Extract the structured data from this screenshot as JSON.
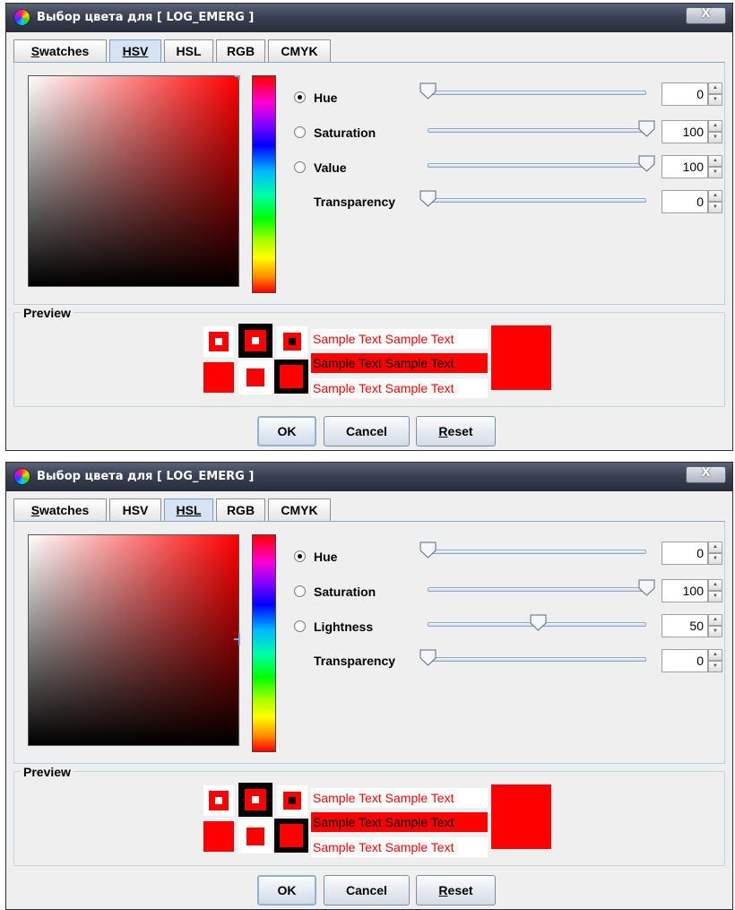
{
  "dialogs": [
    {
      "title": "Выбор цвета для [ LOG_EMERG ]",
      "close_label": "X",
      "tabs": [
        {
          "label": "Swatches",
          "mnemonic": "S",
          "selected": false
        },
        {
          "label": "HSV",
          "mnemonic": "H",
          "selected": true
        },
        {
          "label": "HSL",
          "mnemonic": "L",
          "selected": false
        },
        {
          "label": "RGB",
          "mnemonic": "G",
          "selected": false
        },
        {
          "label": "CMYK",
          "mnemonic": "M",
          "selected": false
        }
      ],
      "rows": [
        {
          "label": "Hue",
          "radio": true,
          "selected": true,
          "value": "0",
          "level": 0
        },
        {
          "label": "Saturation",
          "radio": true,
          "selected": false,
          "value": "100",
          "level": 1
        },
        {
          "label": "Value",
          "radio": true,
          "selected": false,
          "value": "100",
          "level": 1
        },
        {
          "label": "Transparency",
          "radio": false,
          "selected": false,
          "value": "0",
          "level": 0
        }
      ],
      "preview_label": "Preview",
      "sample_text": "Sample Text  Sample Text",
      "buttons": {
        "ok": "OK",
        "cancel": "Cancel",
        "reset": "Reset"
      }
    },
    {
      "title": "Выбор цвета для [ LOG_EMERG ]",
      "close_label": "X",
      "tabs": [
        {
          "label": "Swatches",
          "mnemonic": "S",
          "selected": false
        },
        {
          "label": "HSV",
          "mnemonic": "H",
          "selected": false
        },
        {
          "label": "HSL",
          "mnemonic": "L",
          "selected": true
        },
        {
          "label": "RGB",
          "mnemonic": "G",
          "selected": false
        },
        {
          "label": "CMYK",
          "mnemonic": "M",
          "selected": false
        }
      ],
      "rows": [
        {
          "label": "Hue",
          "radio": true,
          "selected": true,
          "value": "0",
          "level": 0
        },
        {
          "label": "Saturation",
          "radio": true,
          "selected": false,
          "value": "100",
          "level": 1
        },
        {
          "label": "Lightness",
          "radio": true,
          "selected": false,
          "value": "50",
          "level": 0.5
        },
        {
          "label": "Transparency",
          "radio": false,
          "selected": false,
          "value": "0",
          "level": 0
        }
      ],
      "preview_label": "Preview",
      "sample_text": "Sample Text  Sample Text",
      "buttons": {
        "ok": "OK",
        "cancel": "Cancel",
        "reset": "Reset"
      }
    }
  ],
  "colors": {
    "selected": "#ff0000",
    "black": "#000000",
    "white": "#ffffff"
  },
  "icons": {
    "title": "color-wheel-icon",
    "close": "close-icon",
    "thumb": "slider-thumb-icon"
  }
}
